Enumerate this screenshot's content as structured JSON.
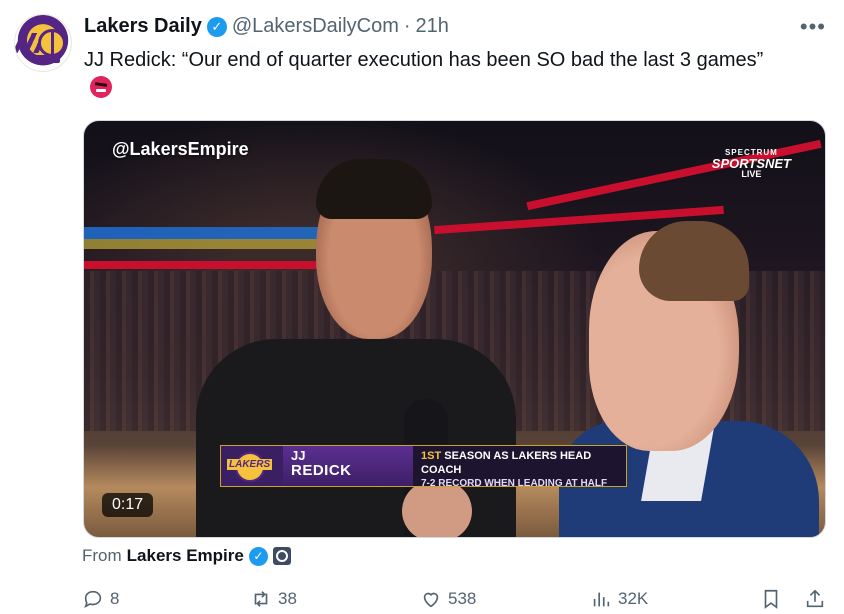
{
  "tweet": {
    "author_name": "Lakers Daily",
    "handle": "@LakersDailyCom",
    "separator": "·",
    "time": "21h",
    "text": "JJ Redick: “Our end of quarter execution has been SO bad the last 3 games”",
    "more_label": "•••"
  },
  "video": {
    "watermark": "@LakersEmpire",
    "network_line1": "SPECTRUM",
    "network_line2": "SPORTSNET",
    "network_line3": "LIVE",
    "lower_third": {
      "logo_text": "LAKERS",
      "first_name": "JJ",
      "last_name": "REDICK",
      "info_highlight": "1ST",
      "info_line1_rest": " SEASON AS LAKERS HEAD COACH",
      "info_line2": "7-2 RECORD WHEN LEADING AT HALF"
    },
    "duration": "0:17"
  },
  "source": {
    "from_label": "From",
    "name": "Lakers Empire"
  },
  "actions": {
    "replies": "8",
    "reposts": "38",
    "likes": "538",
    "views": "32K"
  },
  "colors": {
    "accent": "#1d9bf0",
    "muted": "#536471",
    "lakers_purple": "#552583",
    "lakers_gold": "#f5c23e"
  },
  "icons": [
    "more-icon",
    "verified-icon",
    "reply-icon",
    "repost-icon",
    "like-icon",
    "views-icon",
    "bookmark-icon",
    "share-icon",
    "shield-icon"
  ]
}
